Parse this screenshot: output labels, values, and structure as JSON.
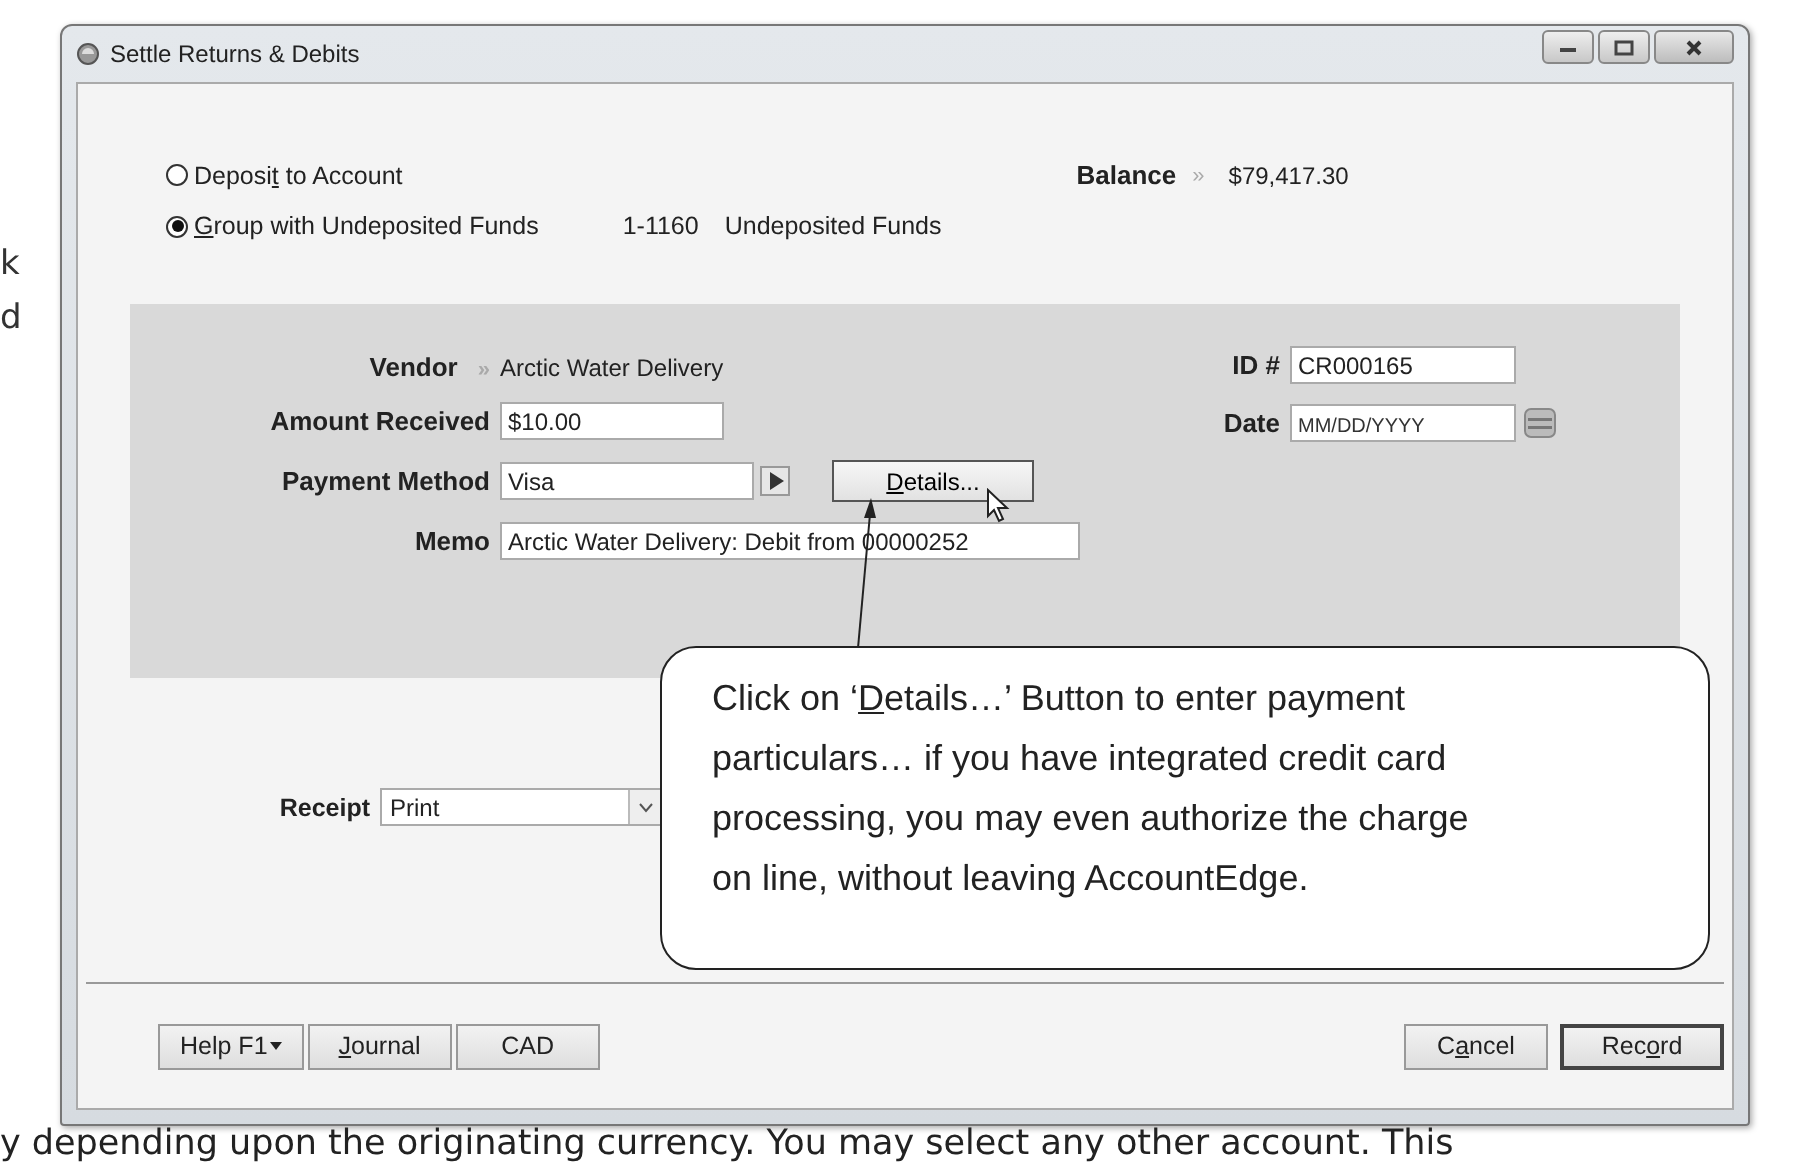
{
  "window": {
    "title": "Settle Returns & Debits"
  },
  "deposit_options": [
    {
      "label": {
        "before": "Deposi",
        "key": "t",
        "after": " to Account"
      },
      "selected": false
    },
    {
      "label": {
        "key": "G",
        "after": "roup with Undeposited Funds"
      },
      "selected": true
    }
  ],
  "account": {
    "number": "1-1160",
    "name": "Undeposited Funds"
  },
  "balance": {
    "label": "Balance",
    "marker": "»",
    "value": "$79,417.30"
  },
  "vendor": {
    "label": "Vendor",
    "marker": "»",
    "value": "Arctic Water Delivery"
  },
  "amount_received": {
    "label": "Amount Received",
    "value": "$10.00"
  },
  "payment_method": {
    "label": "Payment Method",
    "value": "Visa",
    "details_button": {
      "key": "D",
      "after": "etails..."
    }
  },
  "memo": {
    "label": "Memo",
    "value": "Arctic Water Delivery: Debit from 00000252"
  },
  "id_number": {
    "label": "ID #",
    "value": "CR000165"
  },
  "date": {
    "label": "Date",
    "placeholder": "MM/DD/YYYY"
  },
  "receipt": {
    "label": "Receipt",
    "value": "Print"
  },
  "buttons_left": [
    {
      "label": {
        "before": "Help F1"
      },
      "dropdown": true
    },
    {
      "label": {
        "key": "J",
        "after": "ournal"
      },
      "dropdown": false
    },
    {
      "label": {
        "before": "CAD"
      },
      "dropdown": false
    }
  ],
  "buttons_right": [
    {
      "label": {
        "before": "C",
        "key": "a",
        "after": "ncel"
      },
      "default": false
    },
    {
      "label": {
        "before": "Rec",
        "key": "o",
        "after": "rd"
      },
      "default": true
    }
  ],
  "callout": {
    "lines": [
      {
        "before": "Click on ‘",
        "key": "D",
        "after": "etails…’ Button to enter payment"
      },
      {
        "before": "particulars… if you have integrated credit card"
      },
      {
        "before": "processing, you may even authorize the charge"
      },
      {
        "before": "on line, without leaving AccountEdge."
      }
    ]
  },
  "page_text": {
    "margin_fragments": [
      "k",
      "d"
    ],
    "bottom_line": "y depending upon the originating currency.  You may select any other account. This"
  }
}
